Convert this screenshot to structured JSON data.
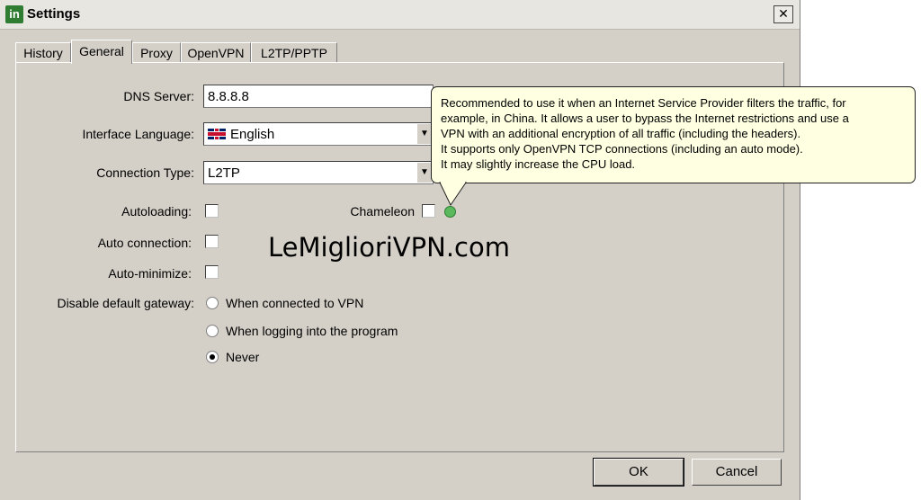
{
  "window": {
    "title": "Settings",
    "app_icon": "in",
    "close_glyph": "✕"
  },
  "tabs": [
    {
      "label": "History",
      "active": false
    },
    {
      "label": "General",
      "active": true
    },
    {
      "label": "Proxy",
      "active": false
    },
    {
      "label": "OpenVPN",
      "active": false
    },
    {
      "label": "L2TP/PPTP",
      "active": false
    }
  ],
  "form": {
    "dns_label": "DNS Server:",
    "dns_value": "8.8.8.8",
    "language_label": "Interface Language:",
    "language_value": "English",
    "connection_label": "Connection Type:",
    "connection_value": "L2TP",
    "autoloading_label": "Autoloading:",
    "autoloading_checked": false,
    "chameleon_label": "Chameleon",
    "chameleon_checked": false,
    "auto_connection_label": "Auto connection:",
    "auto_connection_checked": false,
    "auto_minimize_label": "Auto-minimize:",
    "auto_minimize_checked": false,
    "gateway_label": "Disable default gateway:",
    "gateway_options": [
      {
        "label": "When connected to VPN",
        "selected": false
      },
      {
        "label": "When logging into the program",
        "selected": false
      },
      {
        "label": "Never",
        "selected": true
      }
    ]
  },
  "tooltip": {
    "lines": [
      "Recommended to use it when an Internet Service Provider filters the traffic, for",
      "example, in China. It allows a user to bypass the Internet restrictions and use a",
      "VPN with an additional encryption of all traffic (including the headers).",
      "It supports only OpenVPN TCP connections (including an auto mode).",
      "It may slightly increase the CPU load."
    ]
  },
  "watermark": "LeMiglioriVPN.com",
  "buttons": {
    "ok": "OK",
    "cancel": "Cancel"
  },
  "colors": {
    "window_bg": "#d4d0c8",
    "tooltip_bg": "#ffffe1",
    "help_icon": "#5cb85c",
    "app_icon_bg": "#2e7d32"
  }
}
